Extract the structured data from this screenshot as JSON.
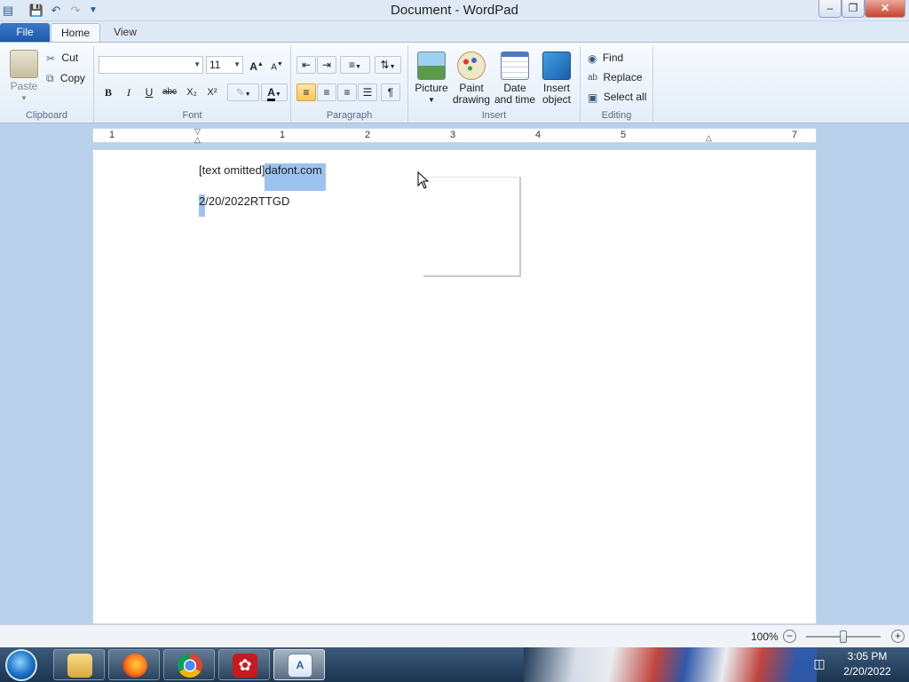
{
  "window": {
    "title": "Document - WordPad"
  },
  "colors": {
    "selection": "#9cc3ef",
    "file_tab": "#1d5aa8",
    "ribbon": "#e3edf8",
    "desktop": "#b9d1ea"
  },
  "quick_access": {
    "icons": [
      "wordpad-app-icon",
      "save-icon",
      "undo-icon",
      "redo-icon",
      "customize-toolbar-icon"
    ]
  },
  "tabs": [
    {
      "label": "File"
    },
    {
      "label": "Home"
    },
    {
      "label": "View"
    }
  ],
  "ribbon": {
    "clipboard": {
      "paste_label": "Paste",
      "cut_label": "Cut",
      "copy_label": "Copy",
      "group_label": "Clipboard"
    },
    "font": {
      "font_name_value": "",
      "font_size_value": "11",
      "bold": "B",
      "italic": "I",
      "underline": "U",
      "strikethrough": "abc",
      "subscript": "X₂",
      "superscript": "X²",
      "group_label": "Font"
    },
    "paragraph": {
      "group_label": "Paragraph",
      "active_alignment": "left"
    },
    "insert": {
      "picture_label": "Picture",
      "paint_label": "Paint drawing",
      "datetime_label": "Date and time",
      "object_label": "Insert object",
      "group_label": "Insert"
    },
    "editing": {
      "find_label": "Find",
      "replace_label": "Replace",
      "select_all_label": "Select all",
      "group_label": "Editing"
    }
  },
  "ruler": {
    "numbers": [
      "1",
      "1",
      "2",
      "3",
      "4",
      "5",
      "7"
    ]
  },
  "document": {
    "line1_plain": "[text omitted]",
    "line1_selected": "dafont.com",
    "line2_selected": "2",
    "line2_plain": "/20/2022RTTGD"
  },
  "statusbar": {
    "zoom": "100%",
    "zoom_out": "−",
    "zoom_in": "+"
  },
  "taskbar": {
    "apps": [
      "file-explorer",
      "firefox",
      "chrome",
      "adobe-reader",
      "wordpad"
    ],
    "time": "3:05 PM",
    "date": "2/20/2022"
  }
}
